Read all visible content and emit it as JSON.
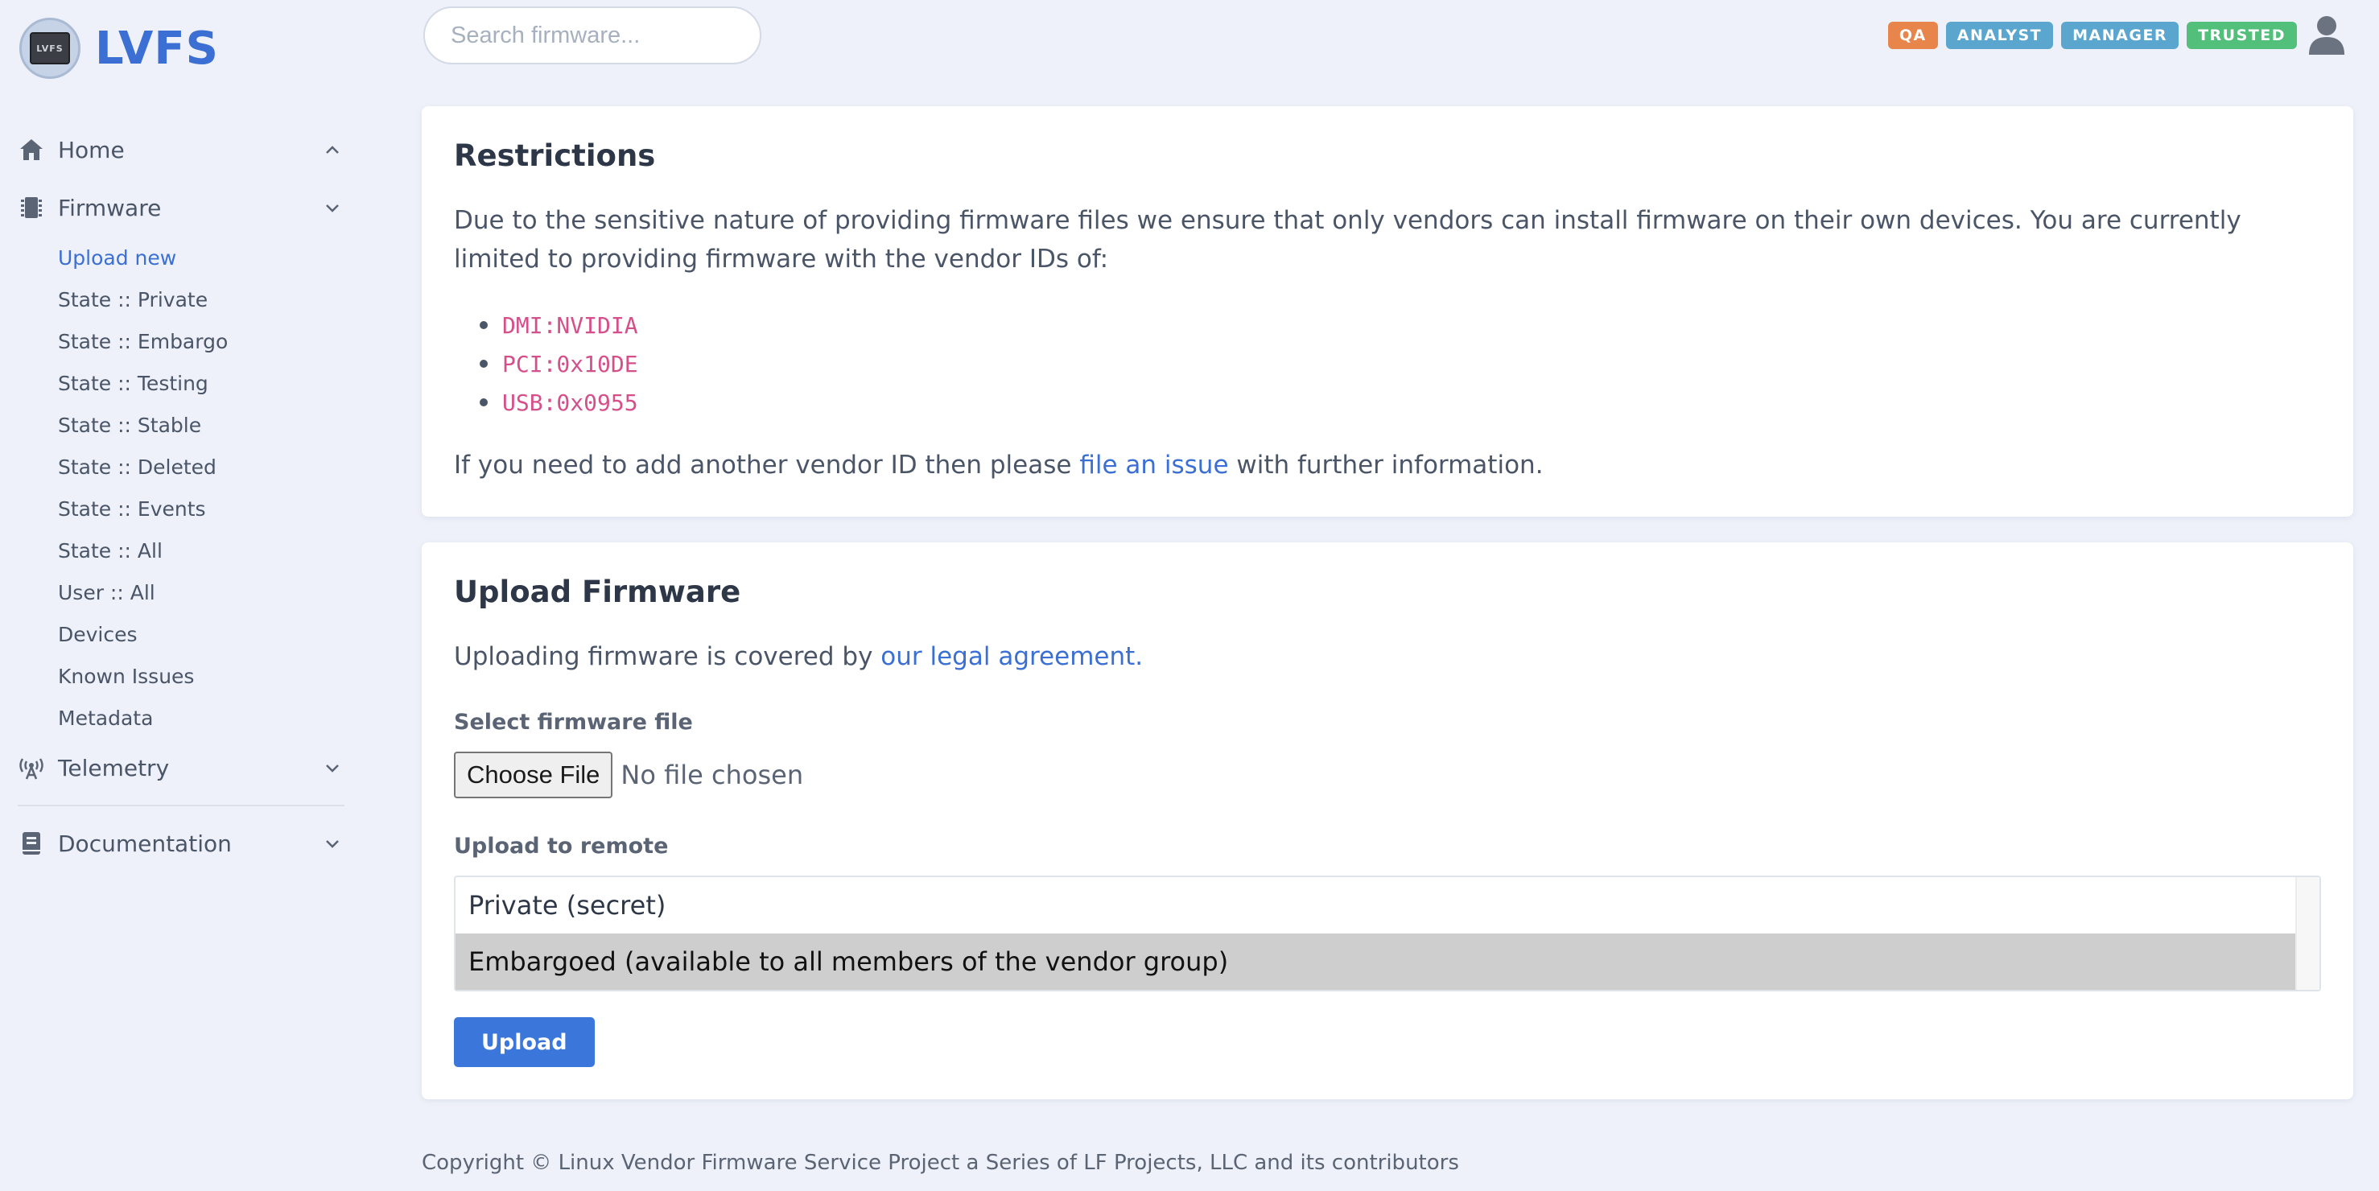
{
  "brand": {
    "name": "LVFS",
    "logo_text": "LVFS"
  },
  "search": {
    "placeholder": "Search firmware..."
  },
  "badges": [
    {
      "label": "QA",
      "color": "#e8854a"
    },
    {
      "label": "ANALYST",
      "color": "#5aa6cf"
    },
    {
      "label": "MANAGER",
      "color": "#5aa6cf"
    },
    {
      "label": "TRUSTED",
      "color": "#52c07a"
    }
  ],
  "sidebar": {
    "home": {
      "label": "Home",
      "icon": "home-icon"
    },
    "firmware": {
      "label": "Firmware",
      "icon": "chip-icon",
      "items": [
        {
          "label": "Upload new",
          "active": true
        },
        {
          "label": "State :: Private"
        },
        {
          "label": "State :: Embargo"
        },
        {
          "label": "State :: Testing"
        },
        {
          "label": "State :: Stable"
        },
        {
          "label": "State :: Deleted"
        },
        {
          "label": "State :: Events"
        },
        {
          "label": "State :: All"
        },
        {
          "label": "User :: All"
        },
        {
          "label": "Devices"
        },
        {
          "label": "Known Issues"
        },
        {
          "label": "Metadata"
        }
      ]
    },
    "telemetry": {
      "label": "Telemetry",
      "icon": "antenna-icon"
    },
    "documentation": {
      "label": "Documentation",
      "icon": "book-icon"
    }
  },
  "restrictions": {
    "title": "Restrictions",
    "text": "Due to the sensitive nature of providing firmware files we ensure that only vendors can install firmware on their own devices. You are currently limited to providing firmware with the vendor IDs of:",
    "vendor_ids": [
      "DMI:NVIDIA",
      "PCI:0x10DE",
      "USB:0x0955"
    ],
    "footer_pre": "If you need to add another vendor ID then please ",
    "footer_link": "file an issue",
    "footer_post": " with further information."
  },
  "upload": {
    "title": "Upload Firmware",
    "legal_pre": "Uploading firmware is covered by ",
    "legal_link": "our legal agreement.",
    "file_label": "Select firmware file",
    "file_button": "Choose File",
    "file_status": "No file chosen",
    "remote_label": "Upload to remote",
    "remote_options": [
      {
        "label": "Private (secret)",
        "selected": false
      },
      {
        "label": "Embargoed (available to all members of the vendor group)",
        "selected": true
      }
    ],
    "submit_label": "Upload"
  },
  "footer": {
    "text": "Copyright © Linux Vendor Firmware Service Project a Series of LF Projects, LLC and its contributors"
  }
}
